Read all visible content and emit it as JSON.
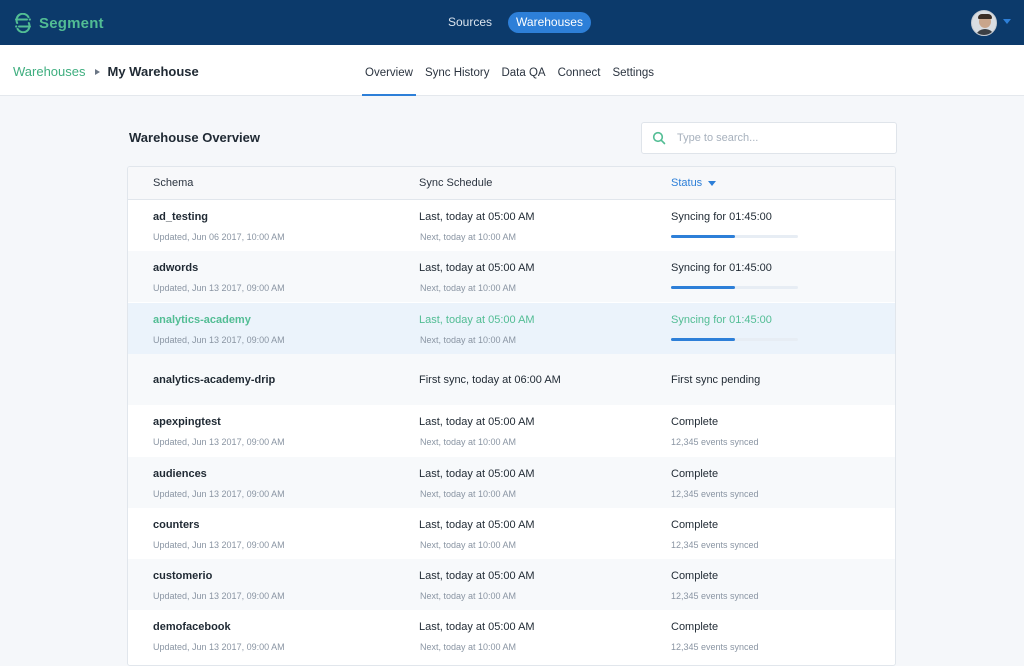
{
  "app": {
    "name": "Segment",
    "brand_color": "#52bd94",
    "header_color": "#0c3a6b",
    "accent": "#2d7fd8"
  },
  "topnav": {
    "sources": "Sources",
    "warehouses": "Warehouses",
    "active": "warehouses"
  },
  "breadcrumb": {
    "parent": "Warehouses",
    "current": "My Warehouse"
  },
  "tabs": [
    {
      "label": "Overview",
      "active": true
    },
    {
      "label": "Sync History",
      "active": false
    },
    {
      "label": "Data QA",
      "active": false
    },
    {
      "label": "Connect",
      "active": false
    },
    {
      "label": "Settings",
      "active": false
    }
  ],
  "main": {
    "title": "Warehouse Overview",
    "search": {
      "placeholder": "Type to search...",
      "value": ""
    }
  },
  "table": {
    "columns": {
      "schema": "Schema",
      "sync_schedule": "Sync Schedule",
      "status": "Status"
    },
    "rows": [
      {
        "name": "ad_testing",
        "updated": "Updated, Jun 06 2017, 10:00 AM",
        "last": "Last, today at 05:00 AM",
        "next": "Next, today at 10:00 AM",
        "status": "Syncing for 01:45:00",
        "status_sub": "",
        "progress": 0.5
      },
      {
        "name": "adwords",
        "updated": "Updated, Jun 13 2017, 09:00 AM",
        "last": "Last, today at 05:00 AM",
        "next": "Next, today at 10:00 AM",
        "status": "Syncing for 01:45:00",
        "status_sub": "",
        "progress": 0.5
      },
      {
        "name": "analytics-academy",
        "updated": "Updated, Jun 13 2017, 09:00 AM",
        "last": "Last, today at 05:00 AM",
        "next": "Next, today at 10:00 AM",
        "status": "Syncing for 01:45:00",
        "status_sub": "",
        "progress": 0.5,
        "selected": true
      },
      {
        "name": "analytics-academy-drip",
        "updated": "",
        "last": "First sync, today at 06:00 AM",
        "next": "",
        "status": "First sync pending",
        "status_sub": "",
        "progress": null
      },
      {
        "name": "apexpingtest",
        "updated": "Updated, Jun 13 2017, 09:00 AM",
        "last": "Last, today at 05:00 AM",
        "next": "Next, today at 10:00 AM",
        "status": "Complete",
        "status_sub": "12,345 events synced",
        "progress": null
      },
      {
        "name": "audiences",
        "updated": "Updated, Jun 13 2017, 09:00 AM",
        "last": "Last, today at 05:00 AM",
        "next": "Next, today at 10:00 AM",
        "status": "Complete",
        "status_sub": "12,345 events synced",
        "progress": null
      },
      {
        "name": "counters",
        "updated": "Updated, Jun 13 2017, 09:00 AM",
        "last": "Last, today at 05:00 AM",
        "next": "Next, today at 10:00 AM",
        "status": "Complete",
        "status_sub": "12,345 events synced",
        "progress": null
      },
      {
        "name": "customerio",
        "updated": "Updated, Jun 13 2017, 09:00 AM",
        "last": "Last, today at 05:00 AM",
        "next": "Next, today at 10:00 AM",
        "status": "Complete",
        "status_sub": "12,345 events synced",
        "progress": null
      },
      {
        "name": "demofacebook",
        "updated": "Updated, Jun 13 2017, 09:00 AM",
        "last": "Last, today at 05:00 AM",
        "next": "Next, today at 10:00 AM",
        "status": "Complete",
        "status_sub": "12,345 events synced",
        "progress": null
      }
    ]
  },
  "icons": {
    "logo": "segment-logo-icon",
    "search": "search-icon",
    "avatar": "user-avatar",
    "dropdown": "caret-down-icon",
    "sort": "sort-caret-icon"
  }
}
